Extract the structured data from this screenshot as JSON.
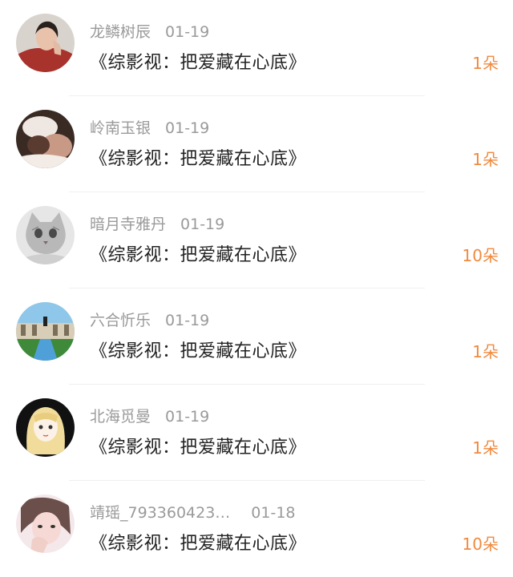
{
  "items": [
    {
      "name": "龙鳞树辰",
      "date": "01-19",
      "title": "《综影视：把爱藏在心底》",
      "amount": "1朵",
      "avatar_icon": "avatar-woman-red-sweater"
    },
    {
      "name": "岭南玉银",
      "date": "01-19",
      "title": "《综影视：把爱藏在心底》",
      "amount": "1朵",
      "avatar_icon": "avatar-couple-embrace"
    },
    {
      "name": "暗月寺雅丹",
      "date": "01-19",
      "title": "《综影视：把爱藏在心底》",
      "amount": "10朵",
      "avatar_icon": "avatar-kitten-sketch"
    },
    {
      "name": "六合忻乐",
      "date": "01-19",
      "title": "《综影视：把爱藏在心底》",
      "amount": "1朵",
      "avatar_icon": "avatar-palace-garden"
    },
    {
      "name": "北海觅曼",
      "date": "01-19",
      "title": "《综影视：把爱藏在心底》",
      "amount": "1朵",
      "avatar_icon": "avatar-anime-girl"
    },
    {
      "name": "靖瑶_793360423…",
      "date": "01-18",
      "title": "《综影视：把爱藏在心底》",
      "amount": "10朵",
      "avatar_icon": "avatar-woman-selfie"
    }
  ],
  "colors": {
    "amount": "#f08a3e",
    "meta": "#9a9a9a",
    "title": "#222222"
  }
}
